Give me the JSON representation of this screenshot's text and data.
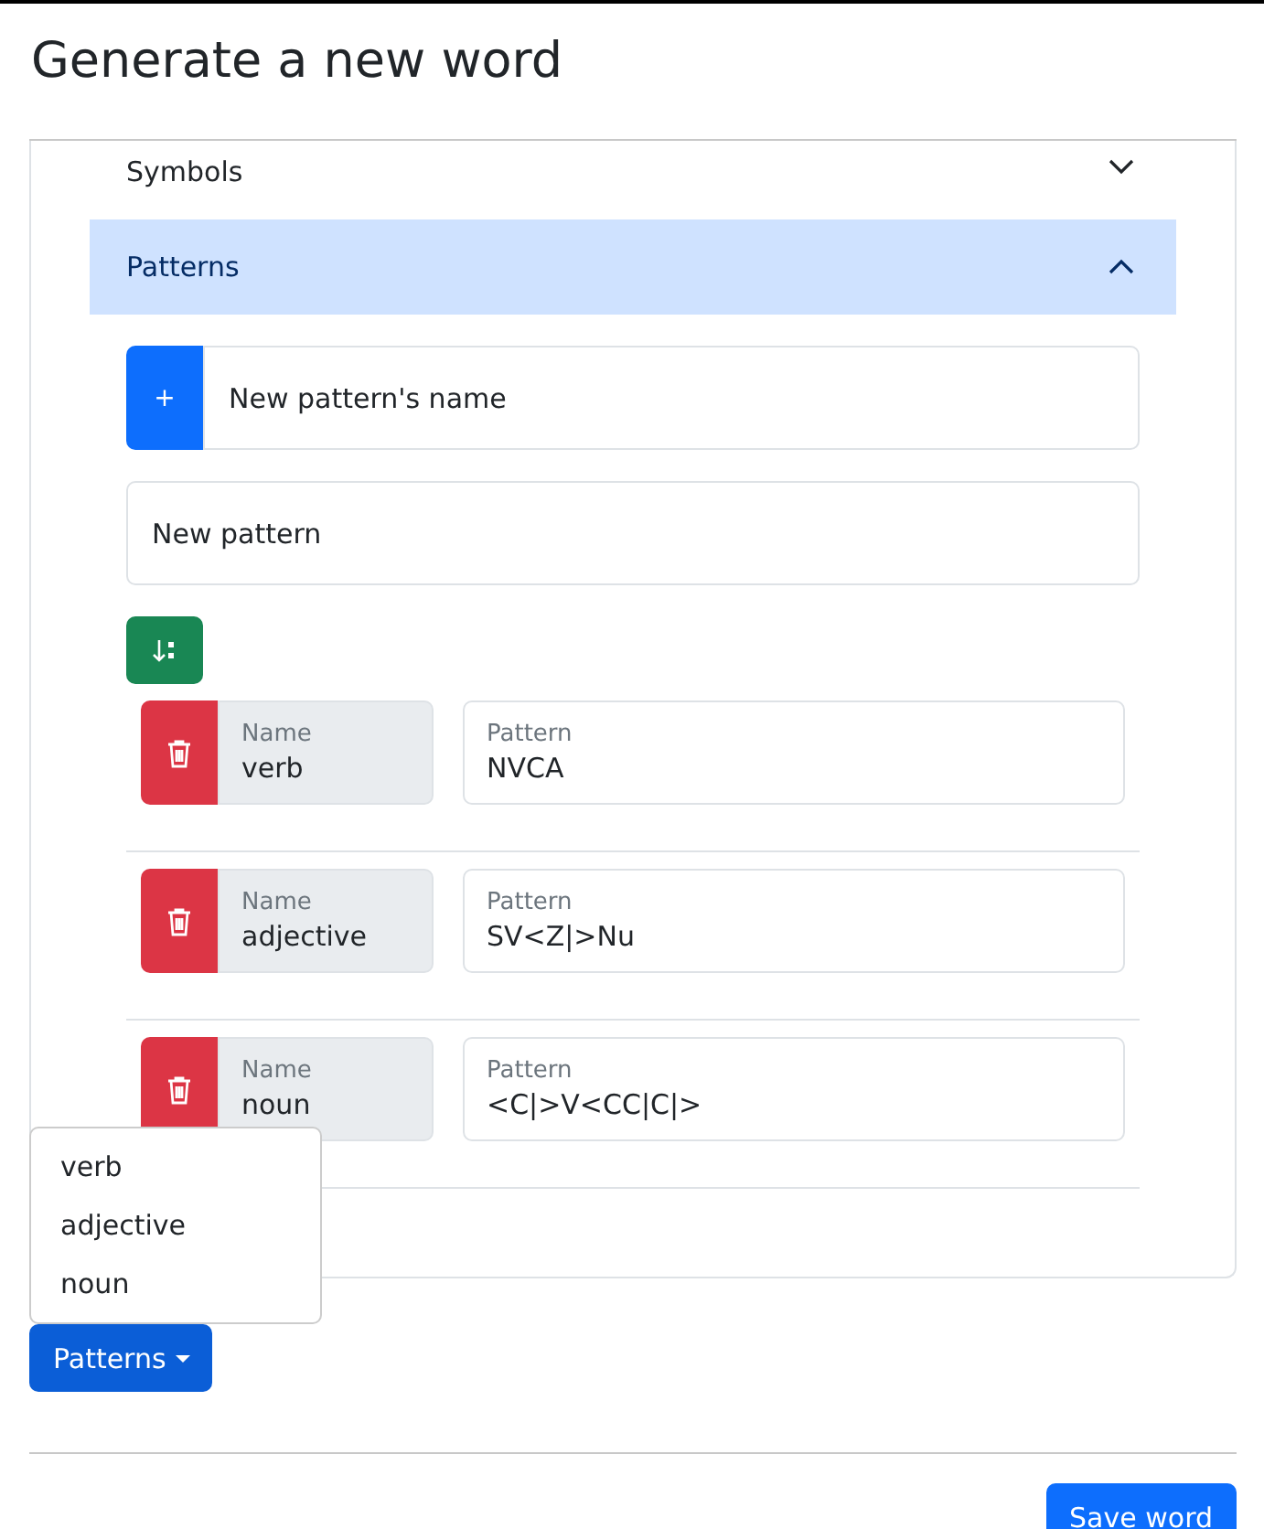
{
  "title": "Generate a new word",
  "accordion": [
    {
      "label": "Symbols",
      "expanded": false
    },
    {
      "label": "Patterns",
      "expanded": true
    }
  ],
  "new_pattern_name": {
    "button": "+",
    "label": "New pattern's name"
  },
  "new_pattern": {
    "label": "New pattern"
  },
  "patterns": [
    {
      "name_label": "Name",
      "name": "verb",
      "pattern_label": "Pattern",
      "pattern": "NVCA"
    },
    {
      "name_label": "Name",
      "name": "adjective",
      "pattern_label": "Pattern",
      "pattern": "SV<Z|>Nu"
    },
    {
      "name_label": "Name",
      "name": "noun",
      "pattern_label": "Pattern",
      "pattern": "<C|>V<CC|C|>"
    }
  ],
  "dropdown": {
    "button": "Patterns",
    "open": true,
    "items": [
      "verb",
      "adjective",
      "noun"
    ]
  },
  "save_button": "Save word"
}
